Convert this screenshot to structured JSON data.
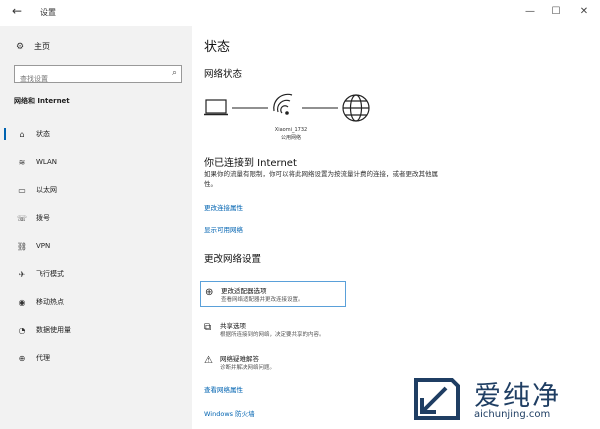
{
  "window": {
    "title": "设置",
    "back_icon": "←",
    "minimize": "—",
    "maximize": "☐",
    "close": "✕"
  },
  "sidebar": {
    "home_label": "主页",
    "search_placeholder": "查找设置",
    "section_title": "网络和 Internet",
    "items": [
      {
        "label": "状态",
        "icon": "status-icon",
        "glyph": "⌂"
      },
      {
        "label": "WLAN",
        "icon": "wifi-icon",
        "glyph": "≋"
      },
      {
        "label": "以太网",
        "icon": "ethernet-icon",
        "glyph": "▭"
      },
      {
        "label": "拨号",
        "icon": "dialup-icon",
        "glyph": "☏"
      },
      {
        "label": "VPN",
        "icon": "vpn-icon",
        "glyph": "⛓"
      },
      {
        "label": "飞行模式",
        "icon": "airplane-icon",
        "glyph": "✈"
      },
      {
        "label": "移动热点",
        "icon": "hotspot-icon",
        "glyph": "◉"
      },
      {
        "label": "数据使用量",
        "icon": "data-usage-icon",
        "glyph": "◔"
      },
      {
        "label": "代理",
        "icon": "proxy-icon",
        "glyph": "⊕"
      }
    ]
  },
  "main": {
    "page_title": "状态",
    "network_status_title": "网络状态",
    "network_name": "Xiaomi_1732",
    "network_type": "公用网络",
    "connected_title": "你已连接到 Internet",
    "connected_desc": "如果你的流量有限制，你可以将此网络设置为按流量计费的连接，或者更改其他属性。",
    "link_change_props": "更改连接属性",
    "link_show_networks": "显示可用网络",
    "change_settings_title": "更改网络设置",
    "options": [
      {
        "title": "更改适配器选项",
        "desc": "查看网络适配器并更改连接设置。"
      },
      {
        "title": "共享选项",
        "desc": "根据所连接到的网络，决定要共享的内容。"
      },
      {
        "title": "网络疑难解答",
        "desc": "诊断并解决网络问题。"
      }
    ],
    "link_view_props": "查看网络属性",
    "link_firewall": "Windows 防火墙"
  },
  "watermark": {
    "text": "爱纯净",
    "url": "aichunjing.com"
  }
}
